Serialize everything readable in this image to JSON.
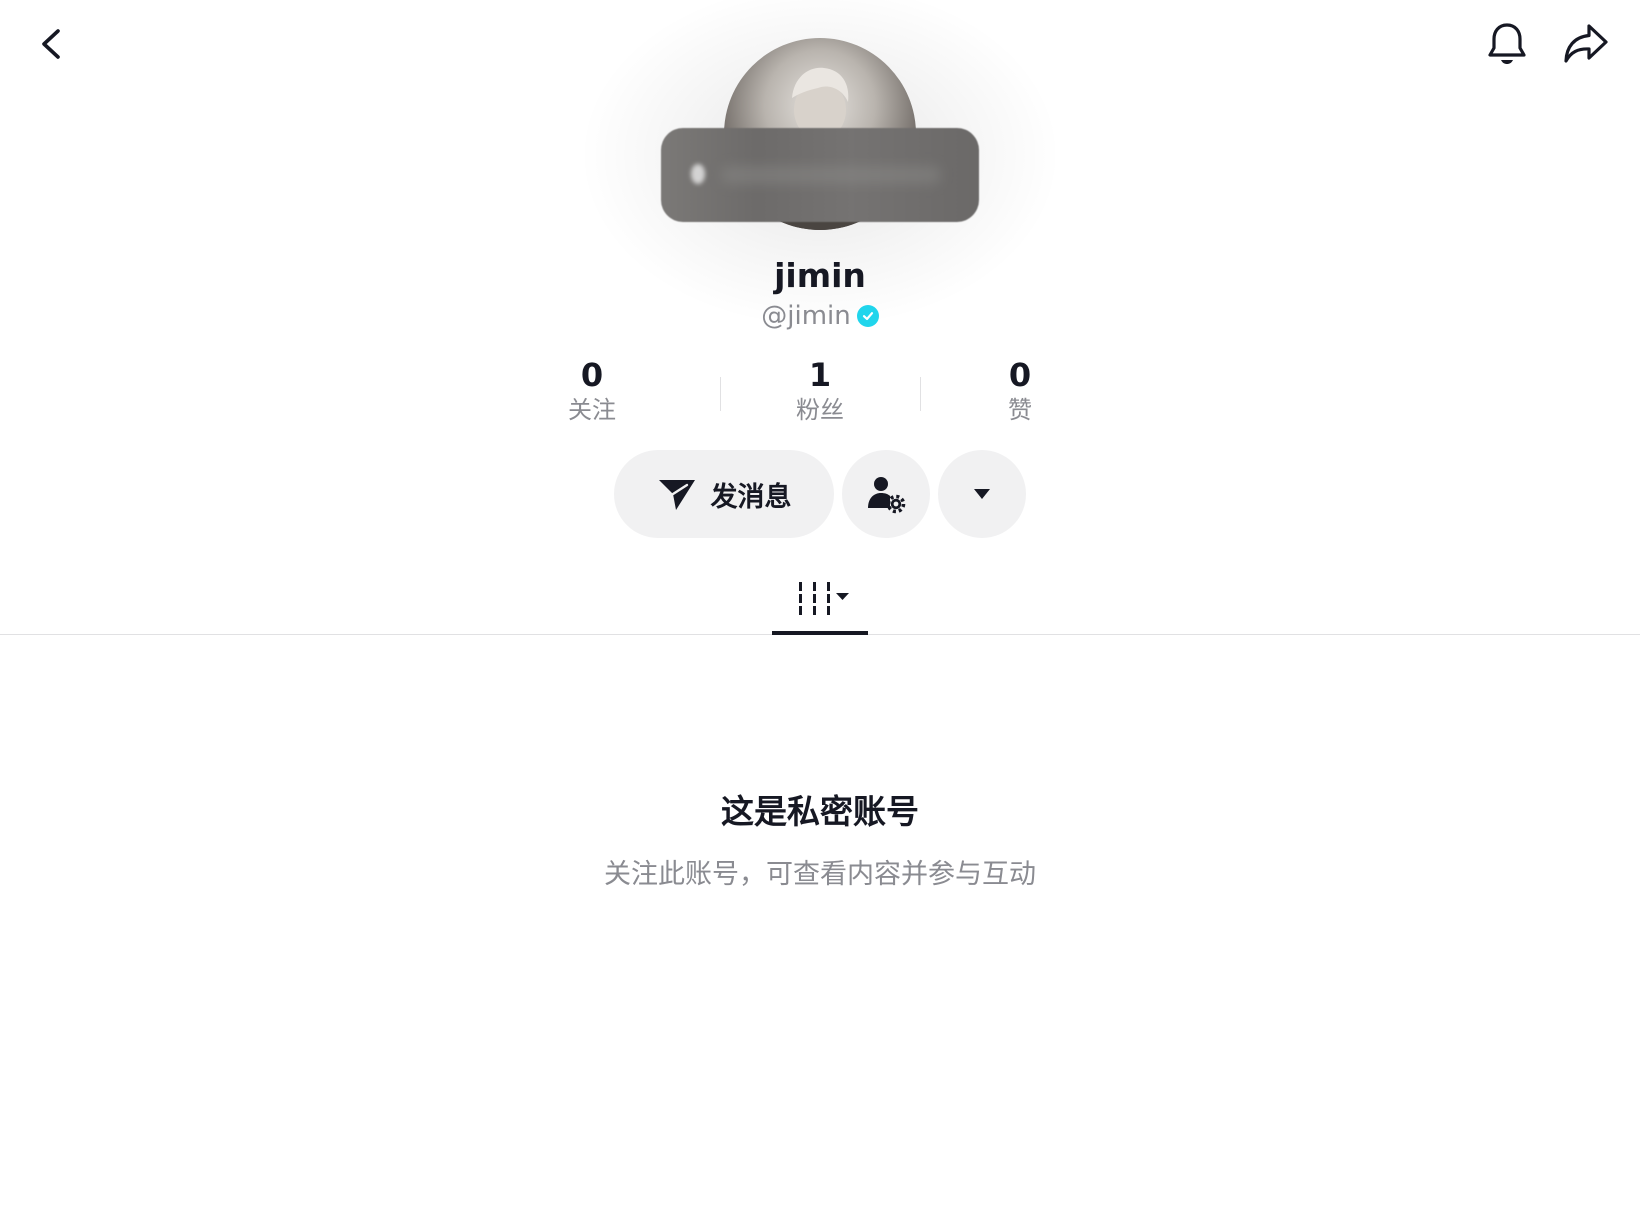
{
  "header": {
    "back_icon": "chevron-left-icon",
    "notification_icon": "bell-icon",
    "share_icon": "share-arrow-icon"
  },
  "profile": {
    "display_name": "jimin",
    "handle": "@jimin",
    "verified": true,
    "verified_color": "#20d5ec"
  },
  "stats": [
    {
      "value": "0",
      "label": "关注"
    },
    {
      "value": "1",
      "label": "粉丝"
    },
    {
      "value": "0",
      "label": "赞"
    }
  ],
  "actions": {
    "message_label": "发消息",
    "message_icon": "send-icon",
    "friend_settings_icon": "user-gear-icon",
    "more_icon": "caret-down-icon"
  },
  "tabs": {
    "videos_icon": "grid-icon"
  },
  "private_notice": {
    "title": "这是私密账号",
    "description": "关注此账号，可查看内容并参与互动"
  }
}
